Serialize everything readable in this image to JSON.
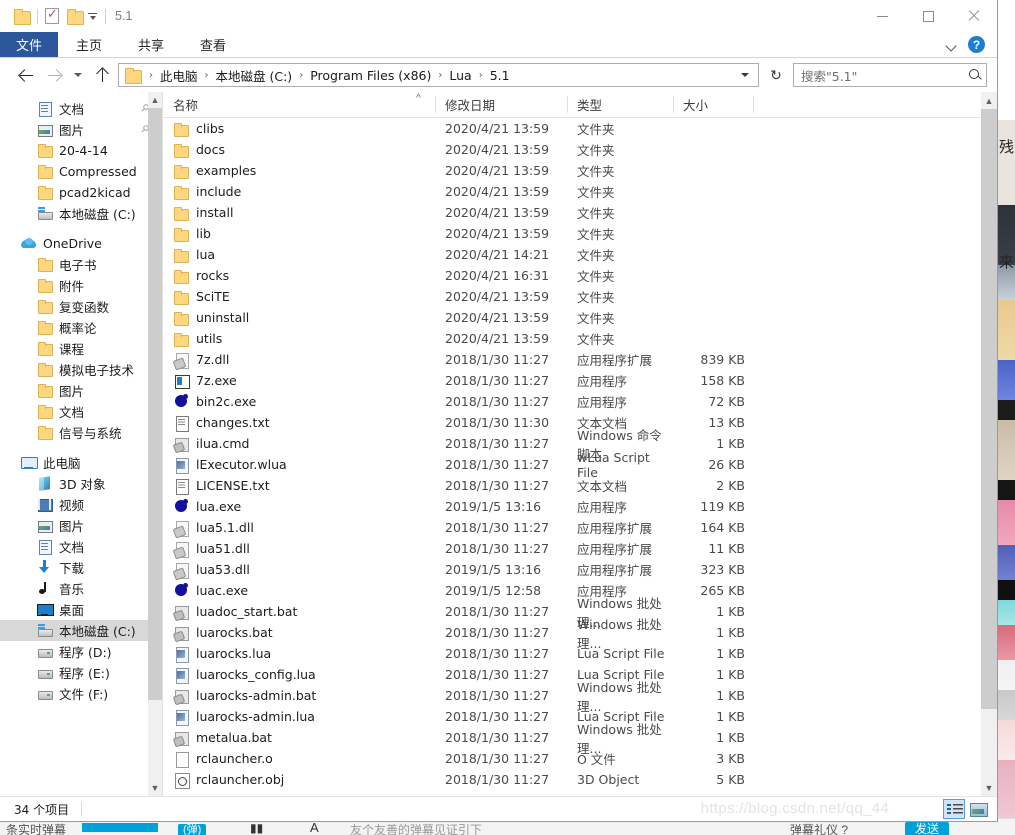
{
  "window": {
    "title": "5.1",
    "quick_access": {
      "folder_icon": "folder-icon",
      "properties_icon": "properties-checkmark-icon",
      "new_folder_icon": "new-folder-icon",
      "customize_icon": "customize-quick-access-caret-icon"
    },
    "controls": {
      "minimize": "minimize-icon",
      "maximize": "maximize-icon",
      "close": "close-icon"
    }
  },
  "ribbon": {
    "file_tab": "文件",
    "tabs": [
      "主页",
      "共享",
      "查看"
    ],
    "collapse_icon": "chevron-down-icon",
    "help_label": "?"
  },
  "addressbar": {
    "back_icon": "back-arrow-icon",
    "forward_icon": "forward-arrow-icon",
    "history_icon": "recent-locations-caret-icon",
    "up_icon": "up-arrow-icon",
    "breadcrumbs": [
      "此电脑",
      "本地磁盘 (C:)",
      "Program Files (x86)",
      "Lua",
      "5.1"
    ],
    "separator": "›",
    "dropdown_icon": "address-dropdown-icon",
    "refresh_label": "↻",
    "search_placeholder": "搜索\"5.1\"",
    "search_value": "",
    "search_icon": "search-icon"
  },
  "navpane": {
    "items": [
      {
        "label": "文档",
        "icon": "documents-icon",
        "indent": 2,
        "pinned": true,
        "selected": false
      },
      {
        "label": "图片",
        "icon": "pictures-icon",
        "indent": 2,
        "pinned": true,
        "selected": false
      },
      {
        "label": "20-4-14",
        "icon": "folder-icon",
        "indent": 2,
        "pinned": false,
        "selected": false
      },
      {
        "label": "Compressed",
        "icon": "folder-icon",
        "indent": 2,
        "pinned": false,
        "selected": false
      },
      {
        "label": "pcad2kicad",
        "icon": "folder-icon",
        "indent": 2,
        "pinned": false,
        "selected": false
      },
      {
        "label": "本地磁盘 (C:)",
        "icon": "drive-c-icon",
        "indent": 2,
        "pinned": false,
        "selected": false
      },
      {
        "label": "OneDrive",
        "icon": "onedrive-icon",
        "indent": 1,
        "pinned": false,
        "selected": false,
        "gap_before": true
      },
      {
        "label": "电子书",
        "icon": "folder-icon",
        "indent": 2,
        "pinned": false,
        "selected": false
      },
      {
        "label": "附件",
        "icon": "folder-icon",
        "indent": 2,
        "pinned": false,
        "selected": false
      },
      {
        "label": "复变函数",
        "icon": "folder-icon",
        "indent": 2,
        "pinned": false,
        "selected": false
      },
      {
        "label": "概率论",
        "icon": "folder-icon",
        "indent": 2,
        "pinned": false,
        "selected": false
      },
      {
        "label": "课程",
        "icon": "folder-icon",
        "indent": 2,
        "pinned": false,
        "selected": false
      },
      {
        "label": "模拟电子技术",
        "icon": "folder-icon",
        "indent": 2,
        "pinned": false,
        "selected": false
      },
      {
        "label": "图片",
        "icon": "folder-icon",
        "indent": 2,
        "pinned": false,
        "selected": false
      },
      {
        "label": "文档",
        "icon": "folder-icon",
        "indent": 2,
        "pinned": false,
        "selected": false
      },
      {
        "label": "信号与系统",
        "icon": "folder-icon",
        "indent": 2,
        "pinned": false,
        "selected": false
      },
      {
        "label": "此电脑",
        "icon": "this-pc-icon",
        "indent": 1,
        "pinned": false,
        "selected": false,
        "gap_before": true
      },
      {
        "label": "3D 对象",
        "icon": "3d-objects-icon",
        "indent": 2,
        "pinned": false,
        "selected": false
      },
      {
        "label": "视频",
        "icon": "videos-icon",
        "indent": 2,
        "pinned": false,
        "selected": false
      },
      {
        "label": "图片",
        "icon": "pictures-icon",
        "indent": 2,
        "pinned": false,
        "selected": false
      },
      {
        "label": "文档",
        "icon": "documents-icon",
        "indent": 2,
        "pinned": false,
        "selected": false
      },
      {
        "label": "下载",
        "icon": "downloads-icon",
        "indent": 2,
        "pinned": false,
        "selected": false
      },
      {
        "label": "音乐",
        "icon": "music-icon",
        "indent": 2,
        "pinned": false,
        "selected": false
      },
      {
        "label": "桌面",
        "icon": "desktop-icon",
        "indent": 2,
        "pinned": false,
        "selected": false
      },
      {
        "label": "本地磁盘 (C:)",
        "icon": "drive-c-icon",
        "indent": 2,
        "pinned": false,
        "selected": true
      },
      {
        "label": "程序 (D:)",
        "icon": "drive-icon",
        "indent": 2,
        "pinned": false,
        "selected": false
      },
      {
        "label": "程序 (E:)",
        "icon": "drive-icon",
        "indent": 2,
        "pinned": false,
        "selected": false
      },
      {
        "label": "文件 (F:)",
        "icon": "drive-icon",
        "indent": 2,
        "pinned": false,
        "selected": false
      }
    ],
    "scroll_up_icon": "scroll-up-icon",
    "scroll_down_icon": "scroll-down-icon"
  },
  "filelist": {
    "columns": [
      {
        "key": "name",
        "label": "名称",
        "sorted": true
      },
      {
        "key": "date",
        "label": "修改日期",
        "sorted": false
      },
      {
        "key": "type",
        "label": "类型",
        "sorted": false
      },
      {
        "key": "size",
        "label": "大小",
        "sorted": false
      }
    ],
    "sort_indicator": "^",
    "rows": [
      {
        "name": "clibs",
        "date": "2020/4/21 13:59",
        "type": "文件夹",
        "size": "",
        "icon": "folder-icon"
      },
      {
        "name": "docs",
        "date": "2020/4/21 13:59",
        "type": "文件夹",
        "size": "",
        "icon": "folder-icon"
      },
      {
        "name": "examples",
        "date": "2020/4/21 13:59",
        "type": "文件夹",
        "size": "",
        "icon": "folder-icon"
      },
      {
        "name": "include",
        "date": "2020/4/21 13:59",
        "type": "文件夹",
        "size": "",
        "icon": "folder-icon"
      },
      {
        "name": "install",
        "date": "2020/4/21 13:59",
        "type": "文件夹",
        "size": "",
        "icon": "folder-icon"
      },
      {
        "name": "lib",
        "date": "2020/4/21 13:59",
        "type": "文件夹",
        "size": "",
        "icon": "folder-icon"
      },
      {
        "name": "lua",
        "date": "2020/4/21 14:21",
        "type": "文件夹",
        "size": "",
        "icon": "folder-icon"
      },
      {
        "name": "rocks",
        "date": "2020/4/21 16:31",
        "type": "文件夹",
        "size": "",
        "icon": "folder-icon"
      },
      {
        "name": "SciTE",
        "date": "2020/4/21 13:59",
        "type": "文件夹",
        "size": "",
        "icon": "folder-icon"
      },
      {
        "name": "uninstall",
        "date": "2020/4/21 13:59",
        "type": "文件夹",
        "size": "",
        "icon": "folder-icon"
      },
      {
        "name": "utils",
        "date": "2020/4/21 13:59",
        "type": "文件夹",
        "size": "",
        "icon": "folder-icon"
      },
      {
        "name": "7z.dll",
        "date": "2018/1/30 11:27",
        "type": "应用程序扩展",
        "size": "839 KB",
        "icon": "dll-icon"
      },
      {
        "name": "7z.exe",
        "date": "2018/1/30 11:27",
        "type": "应用程序",
        "size": "158 KB",
        "icon": "exe-icon"
      },
      {
        "name": "bin2c.exe",
        "date": "2018/1/30 11:27",
        "type": "应用程序",
        "size": "72 KB",
        "icon": "lua-exe-icon"
      },
      {
        "name": "changes.txt",
        "date": "2018/1/30 11:30",
        "type": "文本文档",
        "size": "13 KB",
        "icon": "text-file-icon"
      },
      {
        "name": "ilua.cmd",
        "date": "2018/1/30 11:27",
        "type": "Windows 命令脚本",
        "size": "1 KB",
        "icon": "cmd-script-icon"
      },
      {
        "name": "lExecutor.wlua",
        "date": "2018/1/30 11:27",
        "type": "wLua Script File",
        "size": "26 KB",
        "icon": "wlua-script-icon"
      },
      {
        "name": "LICENSE.txt",
        "date": "2018/1/30 11:27",
        "type": "文本文档",
        "size": "2 KB",
        "icon": "text-file-icon"
      },
      {
        "name": "lua.exe",
        "date": "2019/1/5 13:16",
        "type": "应用程序",
        "size": "119 KB",
        "icon": "lua-exe-icon"
      },
      {
        "name": "lua5.1.dll",
        "date": "2018/1/30 11:27",
        "type": "应用程序扩展",
        "size": "164 KB",
        "icon": "dll-icon"
      },
      {
        "name": "lua51.dll",
        "date": "2018/1/30 11:27",
        "type": "应用程序扩展",
        "size": "11 KB",
        "icon": "dll-icon"
      },
      {
        "name": "lua53.dll",
        "date": "2019/1/5 13:16",
        "type": "应用程序扩展",
        "size": "323 KB",
        "icon": "dll-icon"
      },
      {
        "name": "luac.exe",
        "date": "2019/1/5 12:58",
        "type": "应用程序",
        "size": "265 KB",
        "icon": "lua-exe-icon"
      },
      {
        "name": "luadoc_start.bat",
        "date": "2018/1/30 11:27",
        "type": "Windows 批处理...",
        "size": "1 KB",
        "icon": "bat-script-icon"
      },
      {
        "name": "luarocks.bat",
        "date": "2018/1/30 11:27",
        "type": "Windows 批处理...",
        "size": "1 KB",
        "icon": "bat-script-icon"
      },
      {
        "name": "luarocks.lua",
        "date": "2018/1/30 11:27",
        "type": "Lua Script File",
        "size": "1 KB",
        "icon": "lua-script-icon"
      },
      {
        "name": "luarocks_config.lua",
        "date": "2018/1/30 11:27",
        "type": "Lua Script File",
        "size": "1 KB",
        "icon": "lua-script-icon"
      },
      {
        "name": "luarocks-admin.bat",
        "date": "2018/1/30 11:27",
        "type": "Windows 批处理...",
        "size": "1 KB",
        "icon": "bat-script-icon"
      },
      {
        "name": "luarocks-admin.lua",
        "date": "2018/1/30 11:27",
        "type": "Lua Script File",
        "size": "1 KB",
        "icon": "lua-script-icon"
      },
      {
        "name": "metalua.bat",
        "date": "2018/1/30 11:27",
        "type": "Windows 批处理...",
        "size": "1 KB",
        "icon": "bat-script-icon"
      },
      {
        "name": "rclauncher.o",
        "date": "2018/1/30 11:27",
        "type": "O 文件",
        "size": "3 KB",
        "icon": "o-file-icon"
      },
      {
        "name": "rclauncher.obj",
        "date": "2018/1/30 11:27",
        "type": "3D Object",
        "size": "5 KB",
        "icon": "obj-file-icon"
      }
    ],
    "scroll_up_icon": "scroll-up-icon",
    "scroll_down_icon": "scroll-down-icon"
  },
  "statusbar": {
    "item_count": "34 个项目",
    "watermark": "https://blog.csdn.net/qq_44",
    "view_details_icon": "details-view-icon",
    "view_tiles_icon": "large-icons-view-icon"
  },
  "background": {
    "player_left_text": "条实时弹幕",
    "player_badge": "(弹)",
    "player_font_icon": "A",
    "player_mid_text": "友个友善的弹幕见证引下",
    "player_right_text": "弹幕礼仪 ?",
    "player_send": "发送"
  },
  "colors": {
    "ribbon_file_tab": "#2b579a",
    "folder_yellow": "#fcd77f",
    "selection_gray": "#d8d8d8",
    "accent_blue": "#1a7fd4"
  }
}
